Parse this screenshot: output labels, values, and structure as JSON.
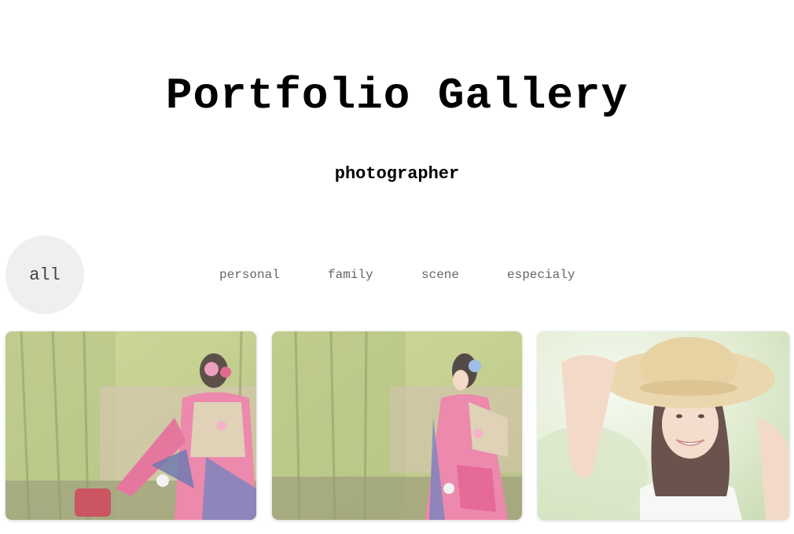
{
  "header": {
    "title": "Portfolio Gallery",
    "subtitle": "photographer"
  },
  "filters": {
    "active": "all",
    "items": [
      "personal",
      "family",
      "scene",
      "especialy"
    ]
  },
  "colors": {
    "active_filter_bg": "#efefef",
    "filter_text": "#666666"
  }
}
